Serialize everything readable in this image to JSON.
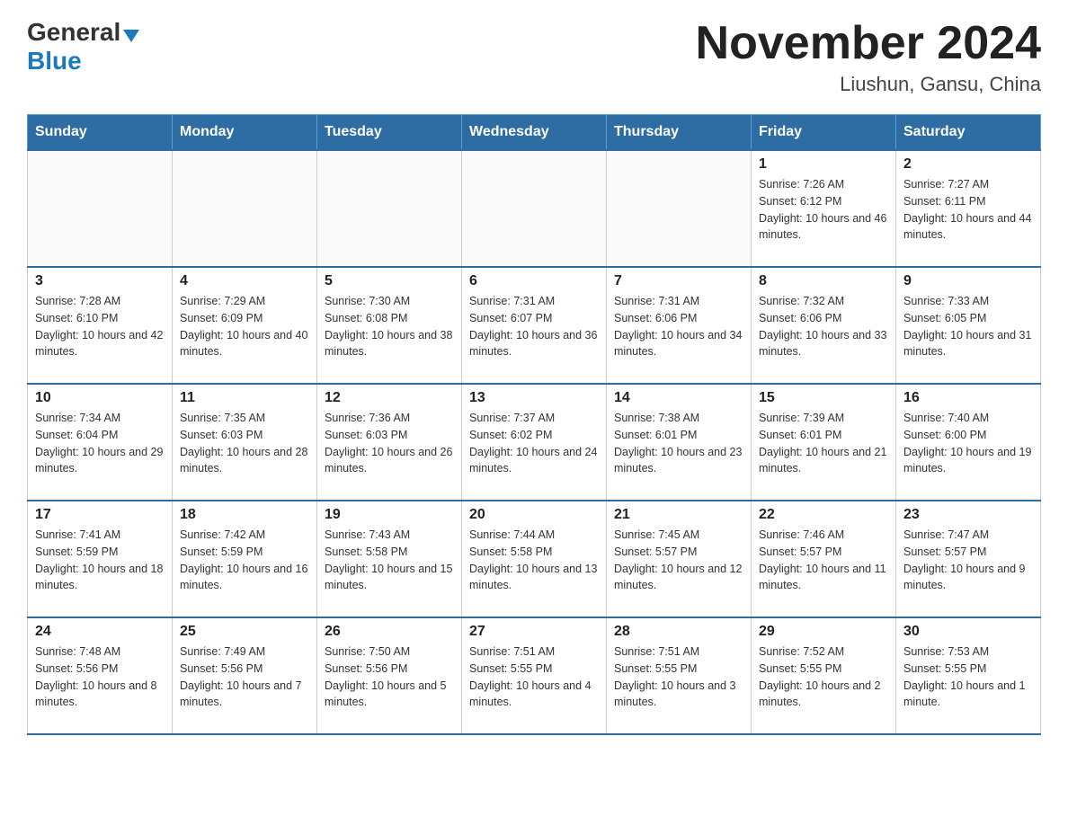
{
  "header": {
    "logo_general": "General",
    "logo_blue": "Blue",
    "month_title": "November 2024",
    "location": "Liushun, Gansu, China"
  },
  "weekdays": [
    "Sunday",
    "Monday",
    "Tuesday",
    "Wednesday",
    "Thursday",
    "Friday",
    "Saturday"
  ],
  "weeks": [
    [
      {
        "day": "",
        "info": ""
      },
      {
        "day": "",
        "info": ""
      },
      {
        "day": "",
        "info": ""
      },
      {
        "day": "",
        "info": ""
      },
      {
        "day": "",
        "info": ""
      },
      {
        "day": "1",
        "info": "Sunrise: 7:26 AM\nSunset: 6:12 PM\nDaylight: 10 hours and 46 minutes."
      },
      {
        "day": "2",
        "info": "Sunrise: 7:27 AM\nSunset: 6:11 PM\nDaylight: 10 hours and 44 minutes."
      }
    ],
    [
      {
        "day": "3",
        "info": "Sunrise: 7:28 AM\nSunset: 6:10 PM\nDaylight: 10 hours and 42 minutes."
      },
      {
        "day": "4",
        "info": "Sunrise: 7:29 AM\nSunset: 6:09 PM\nDaylight: 10 hours and 40 minutes."
      },
      {
        "day": "5",
        "info": "Sunrise: 7:30 AM\nSunset: 6:08 PM\nDaylight: 10 hours and 38 minutes."
      },
      {
        "day": "6",
        "info": "Sunrise: 7:31 AM\nSunset: 6:07 PM\nDaylight: 10 hours and 36 minutes."
      },
      {
        "day": "7",
        "info": "Sunrise: 7:31 AM\nSunset: 6:06 PM\nDaylight: 10 hours and 34 minutes."
      },
      {
        "day": "8",
        "info": "Sunrise: 7:32 AM\nSunset: 6:06 PM\nDaylight: 10 hours and 33 minutes."
      },
      {
        "day": "9",
        "info": "Sunrise: 7:33 AM\nSunset: 6:05 PM\nDaylight: 10 hours and 31 minutes."
      }
    ],
    [
      {
        "day": "10",
        "info": "Sunrise: 7:34 AM\nSunset: 6:04 PM\nDaylight: 10 hours and 29 minutes."
      },
      {
        "day": "11",
        "info": "Sunrise: 7:35 AM\nSunset: 6:03 PM\nDaylight: 10 hours and 28 minutes."
      },
      {
        "day": "12",
        "info": "Sunrise: 7:36 AM\nSunset: 6:03 PM\nDaylight: 10 hours and 26 minutes."
      },
      {
        "day": "13",
        "info": "Sunrise: 7:37 AM\nSunset: 6:02 PM\nDaylight: 10 hours and 24 minutes."
      },
      {
        "day": "14",
        "info": "Sunrise: 7:38 AM\nSunset: 6:01 PM\nDaylight: 10 hours and 23 minutes."
      },
      {
        "day": "15",
        "info": "Sunrise: 7:39 AM\nSunset: 6:01 PM\nDaylight: 10 hours and 21 minutes."
      },
      {
        "day": "16",
        "info": "Sunrise: 7:40 AM\nSunset: 6:00 PM\nDaylight: 10 hours and 19 minutes."
      }
    ],
    [
      {
        "day": "17",
        "info": "Sunrise: 7:41 AM\nSunset: 5:59 PM\nDaylight: 10 hours and 18 minutes."
      },
      {
        "day": "18",
        "info": "Sunrise: 7:42 AM\nSunset: 5:59 PM\nDaylight: 10 hours and 16 minutes."
      },
      {
        "day": "19",
        "info": "Sunrise: 7:43 AM\nSunset: 5:58 PM\nDaylight: 10 hours and 15 minutes."
      },
      {
        "day": "20",
        "info": "Sunrise: 7:44 AM\nSunset: 5:58 PM\nDaylight: 10 hours and 13 minutes."
      },
      {
        "day": "21",
        "info": "Sunrise: 7:45 AM\nSunset: 5:57 PM\nDaylight: 10 hours and 12 minutes."
      },
      {
        "day": "22",
        "info": "Sunrise: 7:46 AM\nSunset: 5:57 PM\nDaylight: 10 hours and 11 minutes."
      },
      {
        "day": "23",
        "info": "Sunrise: 7:47 AM\nSunset: 5:57 PM\nDaylight: 10 hours and 9 minutes."
      }
    ],
    [
      {
        "day": "24",
        "info": "Sunrise: 7:48 AM\nSunset: 5:56 PM\nDaylight: 10 hours and 8 minutes."
      },
      {
        "day": "25",
        "info": "Sunrise: 7:49 AM\nSunset: 5:56 PM\nDaylight: 10 hours and 7 minutes."
      },
      {
        "day": "26",
        "info": "Sunrise: 7:50 AM\nSunset: 5:56 PM\nDaylight: 10 hours and 5 minutes."
      },
      {
        "day": "27",
        "info": "Sunrise: 7:51 AM\nSunset: 5:55 PM\nDaylight: 10 hours and 4 minutes."
      },
      {
        "day": "28",
        "info": "Sunrise: 7:51 AM\nSunset: 5:55 PM\nDaylight: 10 hours and 3 minutes."
      },
      {
        "day": "29",
        "info": "Sunrise: 7:52 AM\nSunset: 5:55 PM\nDaylight: 10 hours and 2 minutes."
      },
      {
        "day": "30",
        "info": "Sunrise: 7:53 AM\nSunset: 5:55 PM\nDaylight: 10 hours and 1 minute."
      }
    ]
  ]
}
